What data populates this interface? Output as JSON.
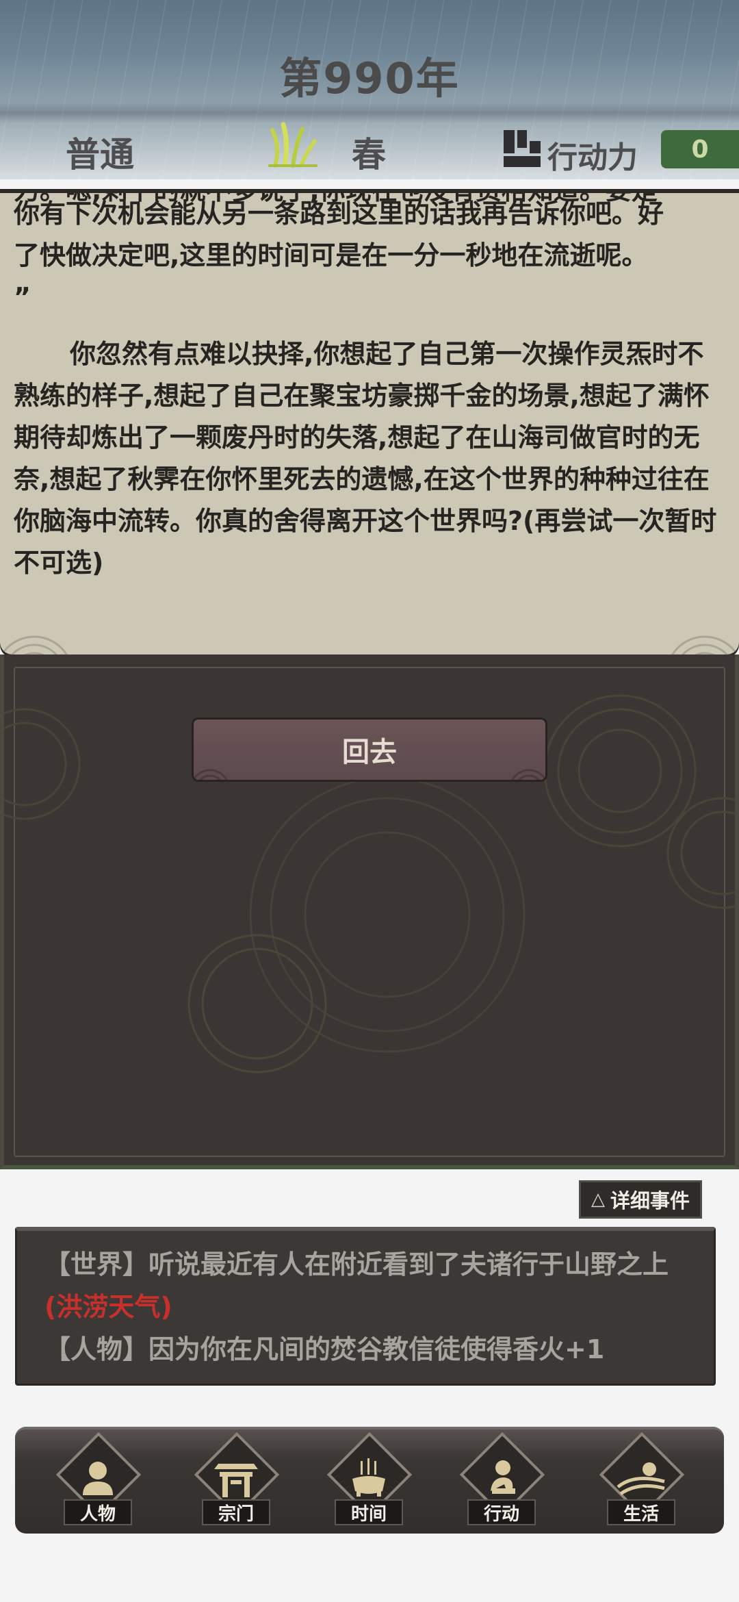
{
  "header": {
    "year": "第990年",
    "difficulty": "普通",
    "season": "春",
    "action_points_label": "行动力",
    "action_points_value": "0"
  },
  "story": {
    "line_cut": "力。嗯,剩下的就不多说了,你现在也没有资格知道。要是",
    "line_1": "你有下次机会能从另一条路到这里的话我再告诉你吧。好",
    "line_2": "了快做决定吧,这里的时间可是在一分一秒地在流逝呢。",
    "line_3": "”",
    "para_2": "你忽然有点难以抉择,你想起了自己第一次操作灵炁时不熟练的样子,想起了自己在聚宝坊豪掷千金的场景,想起了满怀期待却炼出了一颗废丹时的失落,想起了在山海司做官时的无奈,想起了秋霁在你怀里死去的遗憾,在这个世界的种种过往在你脑海中流转。你真的舍得离开这个世界吗?(再尝试一次暂时不可选)"
  },
  "actions": {
    "back_label": "回去"
  },
  "events": {
    "detail_button_label": "详细事件",
    "detail_button_icon": "triangle-icon",
    "world_prefix": "【世界】",
    "world_text": "听说最近有人在附近看到了夫诸行于山野之上",
    "world_highlight": "(洪涝天气)",
    "person_prefix": "【人物】",
    "person_text": "因为你在凡间的焚谷教信徒使得香火+1",
    "highlight_color": "#c9302c"
  },
  "nav": {
    "items": [
      {
        "label": "人物",
        "icon": "person-icon"
      },
      {
        "label": "宗门",
        "icon": "sect-gate-icon"
      },
      {
        "label": "时间",
        "icon": "incense-burner-icon"
      },
      {
        "label": "行动",
        "icon": "action-figure-icon"
      },
      {
        "label": "生活",
        "icon": "landscape-sun-icon"
      }
    ]
  }
}
